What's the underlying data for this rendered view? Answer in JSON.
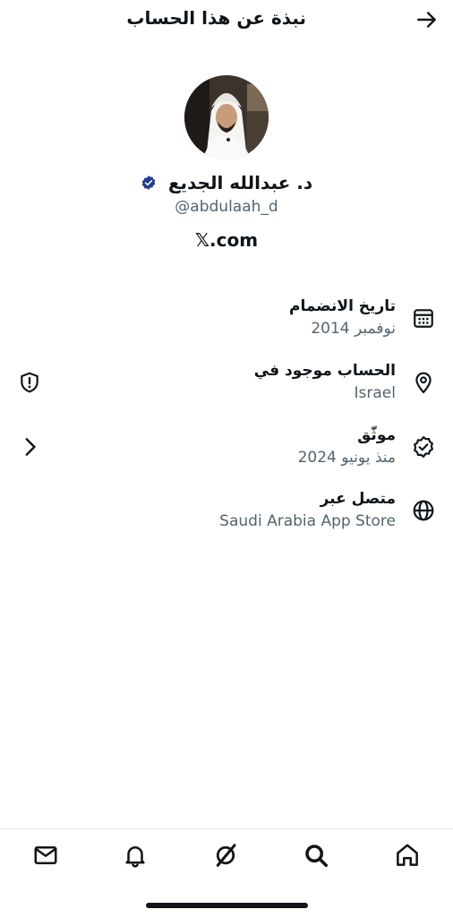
{
  "header": {
    "title": "نبذة عن هذا الحساب",
    "back_icon": "arrow-right-icon"
  },
  "profile": {
    "display_name": "د. عبدالله الجديع",
    "handle": "@abdulaah_d",
    "site": "𝕏.com",
    "verified_color": "#1d9bf0"
  },
  "rows": [
    {
      "icon": "calendar-icon",
      "title": "تاريخ الانضمام",
      "value": "نوفمبر 2014"
    },
    {
      "icon": "location-pin-icon",
      "title": "الحساب موجود في",
      "value": "Israel",
      "left_icon": "shield-exclamation-icon"
    },
    {
      "icon": "verified-badge-icon",
      "title": "موثّق",
      "value": "منذ يونيو 2024",
      "left_icon": "chevron-left-icon"
    },
    {
      "icon": "globe-icon",
      "title": "متصل عبر",
      "value": "Saudi Arabia App Store"
    }
  ],
  "tabbar": {
    "tabs": [
      "mail-icon",
      "bell-icon",
      "grok-icon",
      "search-icon",
      "home-icon"
    ]
  }
}
